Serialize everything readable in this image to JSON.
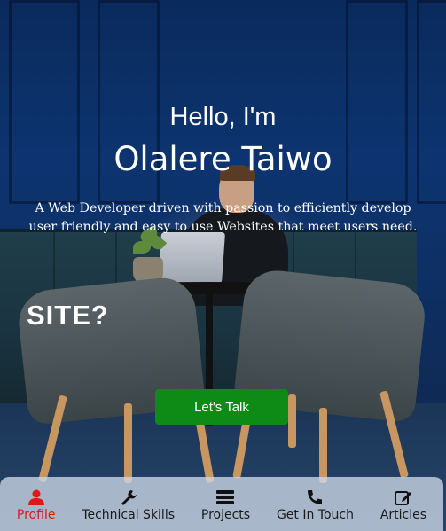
{
  "hero": {
    "greeting": "Hello, I'm",
    "name": "Olalere Taiwo",
    "tagline": "A Web Developer driven with passion to efficiently develop user friendly and easy to use Websites that meet users need.",
    "background_text": "SITE?",
    "cta_label": "Let's Talk"
  },
  "nav": {
    "items": [
      {
        "label": "Profile",
        "icon": "user-icon",
        "active": true
      },
      {
        "label": "Technical Skills",
        "icon": "wrench-icon",
        "active": false
      },
      {
        "label": "Projects",
        "icon": "stack-icon",
        "active": false
      },
      {
        "label": "Get In Touch",
        "icon": "phone-icon",
        "active": false
      },
      {
        "label": "Articles",
        "icon": "edit-icon",
        "active": false
      }
    ]
  },
  "colors": {
    "cta": "#0e8a17",
    "active_nav": "#e01818",
    "nav_bg": "#cdd7e6"
  }
}
